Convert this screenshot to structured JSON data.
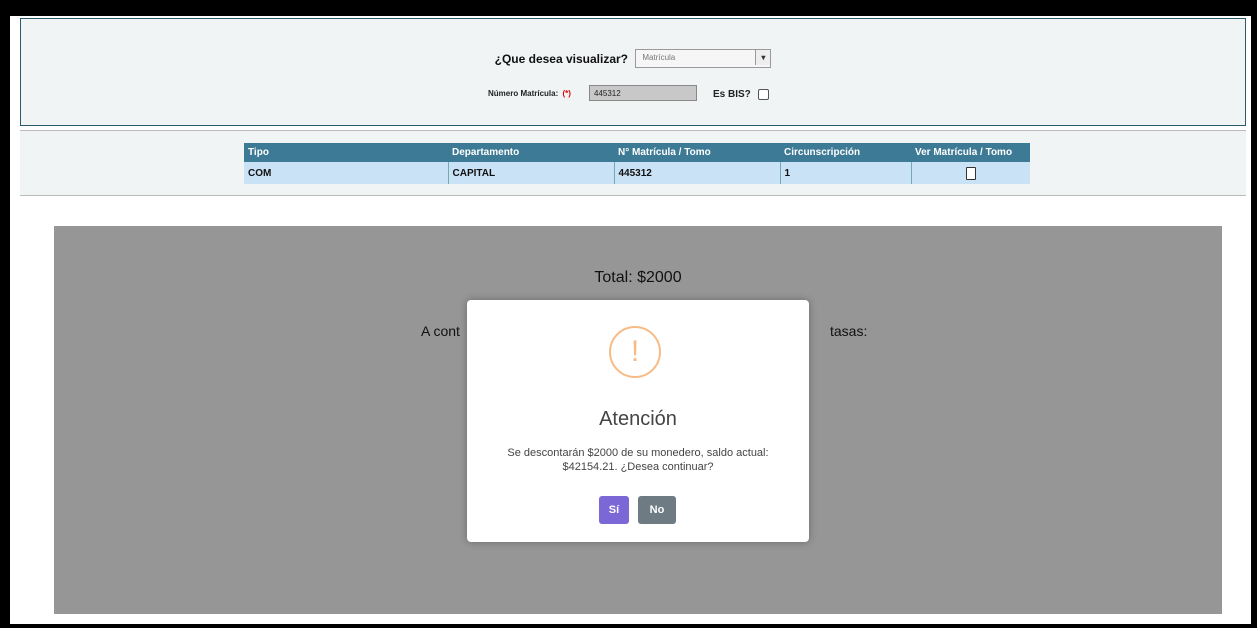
{
  "header": {
    "question_label": "¿Que desea visualizar?",
    "select_value": "Matrícula",
    "numero_label": "Número Matrícula:",
    "required_mark": "(*)",
    "numero_value": "445312",
    "bis_label": "Es BIS?"
  },
  "table": {
    "columns": [
      "Tipo",
      "Departamento",
      "N° Matrícula / Tomo",
      "Circunscripción",
      "Ver Matrícula / Tomo"
    ],
    "rows": [
      {
        "tipo": "COM",
        "departamento": "CAPITAL",
        "matricula": "445312",
        "circunscripcion": "1"
      }
    ]
  },
  "background_content": {
    "total": "Total: $2000",
    "partial_text_left": "A cont",
    "partial_text_right": "tasas:"
  },
  "modal": {
    "icon": "exclamation",
    "title": "Atención",
    "message": "Se descontarán $2000 de su monedero, saldo actual: $42154.21. ¿Desea continuar?",
    "yes_label": "Sí",
    "no_label": "No"
  }
}
